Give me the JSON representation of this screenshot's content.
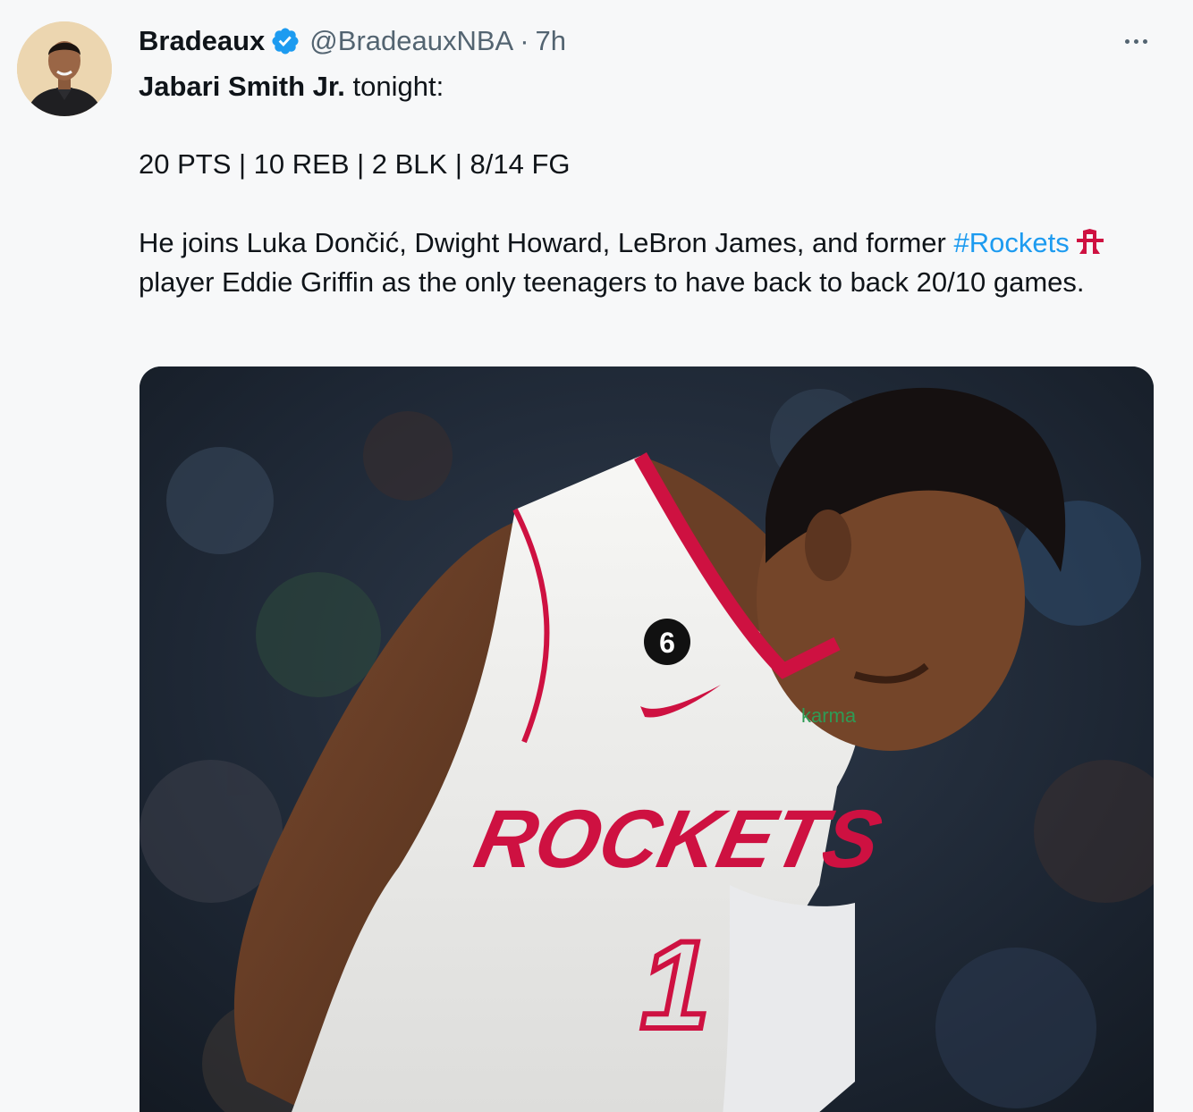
{
  "tweet": {
    "author": {
      "display_name": "Bradeaux",
      "verified_icon": "verified-badge-icon",
      "handle": "@BradeauxNBA",
      "separator": "·",
      "time": "7h"
    },
    "more_icon": "more-horizontal-icon",
    "text": {
      "line1_bold": "Jabari Smith Jr.",
      "line1_rest": " tonight:",
      "line2": "20 PTS | 10 REB | 2 BLK | 8/14 FG",
      "line3_part1": "He joins Luka Dončić, Dwight Howard, LeBron James, and former",
      "hashtag": "#Rockets",
      "line3_part2": "player Eddie Griffin as the only teenagers to have back to back 20/10 games."
    },
    "media": {
      "jersey_text": "ROCKETS",
      "jersey_number": "1",
      "patch_number": "6",
      "sponsor": "karma"
    },
    "colors": {
      "link": "#1d9bf0",
      "verified": "#1d9bf0",
      "rockets_red": "#ce1141"
    }
  }
}
